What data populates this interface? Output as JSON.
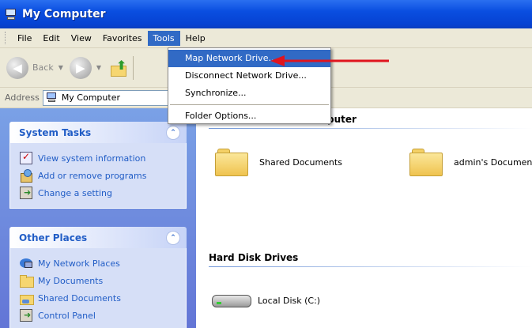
{
  "window": {
    "title": "My Computer"
  },
  "menubar": {
    "items": [
      "File",
      "Edit",
      "View",
      "Favorites",
      "Tools",
      "Help"
    ],
    "active": "Tools"
  },
  "toolbar": {
    "back_label": "Back"
  },
  "address": {
    "label": "Address",
    "value": "My Computer"
  },
  "tools_menu": {
    "items": [
      "Map Network Drive...",
      "Disconnect Network Drive...",
      "Synchronize...",
      "Folder Options..."
    ],
    "highlighted": "Map Network Drive..."
  },
  "sidebar": {
    "system_tasks": {
      "title": "System Tasks",
      "items": [
        "View system information",
        "Add or remove programs",
        "Change a setting"
      ]
    },
    "other_places": {
      "title": "Other Places",
      "items": [
        "My Network Places",
        "My Documents",
        "Shared Documents",
        "Control Panel"
      ]
    }
  },
  "main": {
    "section1_title_fragment": "puter",
    "files": [
      "Shared Documents",
      "admin's Documents"
    ],
    "section2_title": "Hard Disk Drives",
    "drives": [
      "Local Disk (C:)"
    ]
  },
  "annotation": {
    "arrow_color": "#e0141e"
  },
  "colors": {
    "title_blue": "#0a4ee0",
    "menu_highlight": "#316ac5",
    "task_text": "#215dc6"
  }
}
